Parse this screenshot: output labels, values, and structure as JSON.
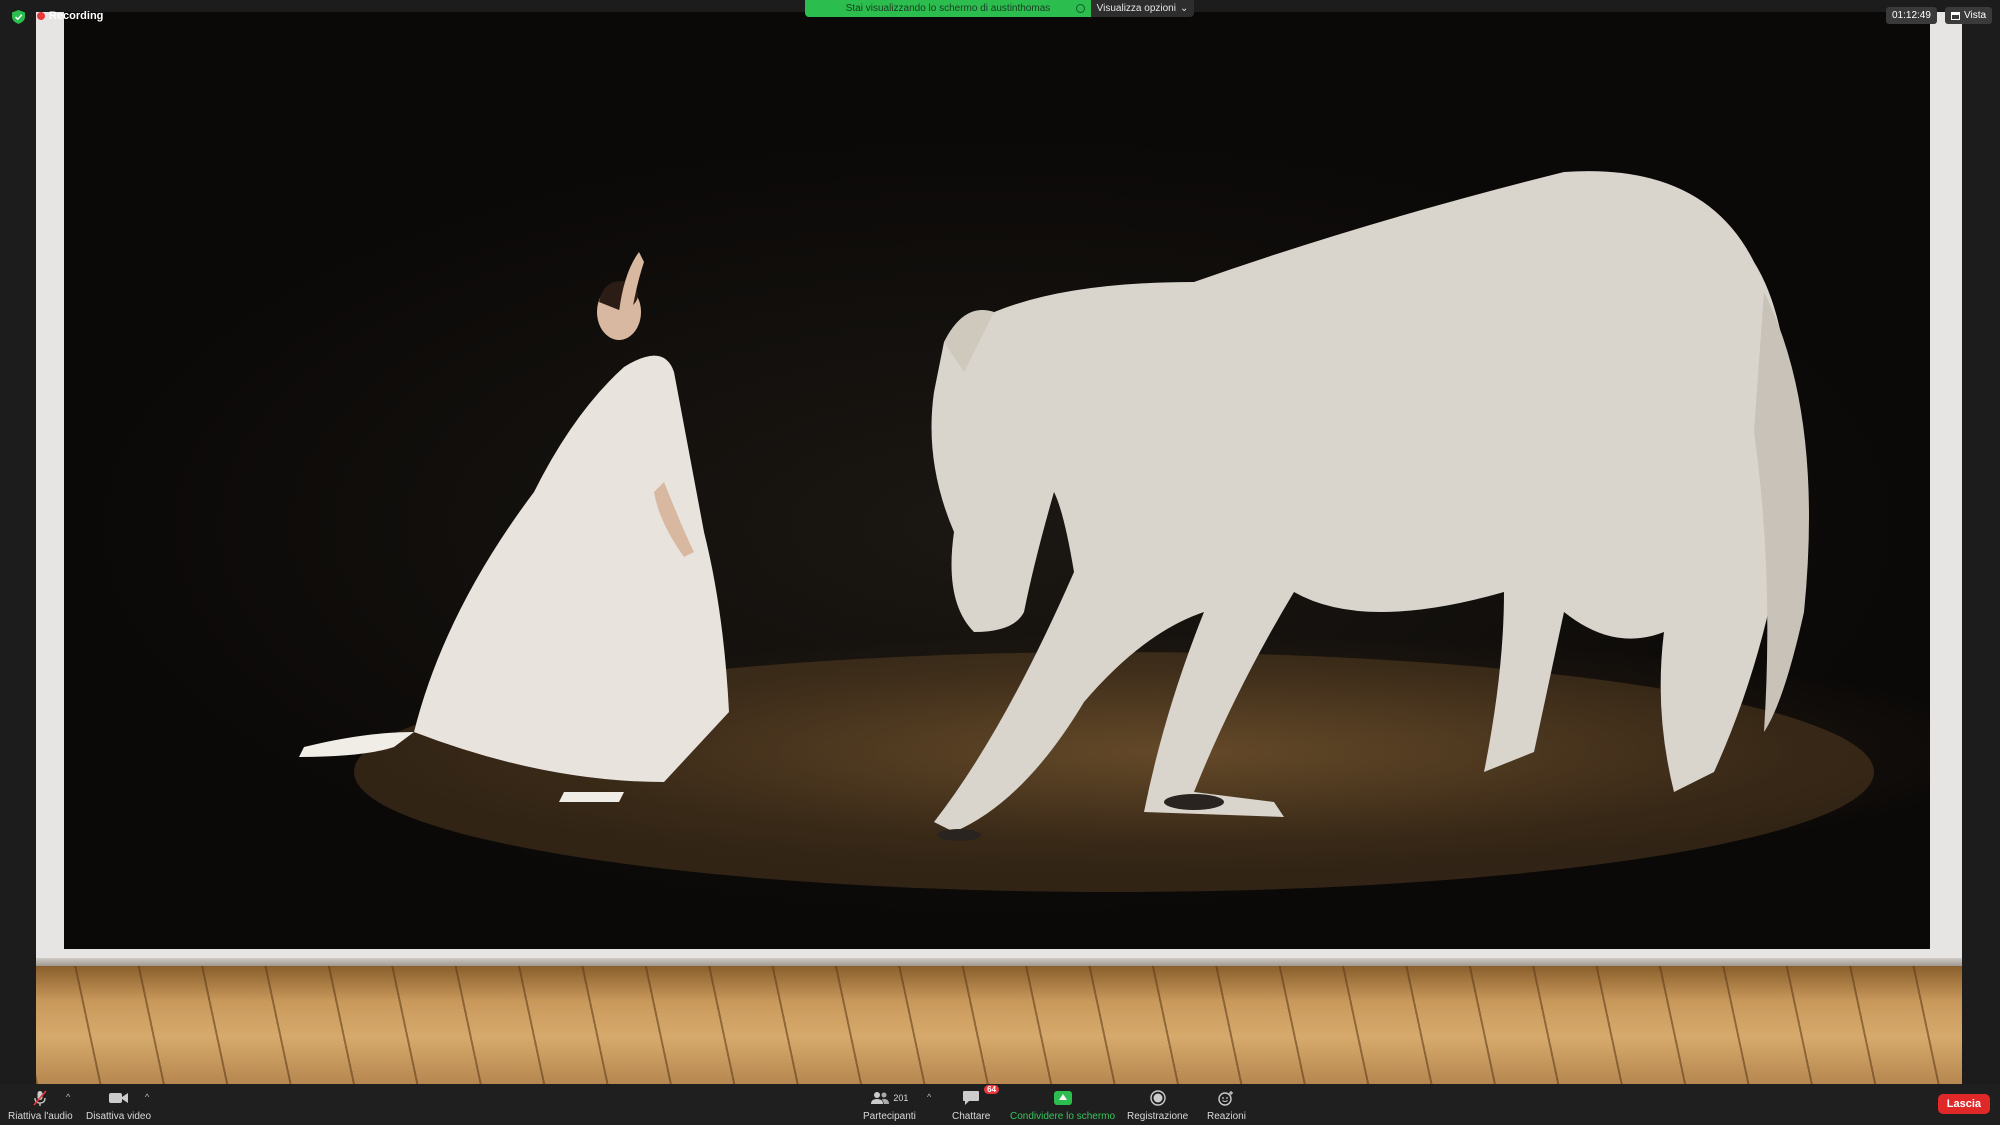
{
  "topbar": {
    "recording_label": "Recording",
    "share_banner_text": "Stai visualizzando lo schermo di austinthomas",
    "view_options_label": "Visualizza opzioni",
    "timer": "01:12:49",
    "view_label": "Vista"
  },
  "toolbar": {
    "audio_label": "Riattiva l'audio",
    "video_label": "Disattiva video",
    "participants_label": "Partecipanti",
    "participants_count": "201",
    "chat_label": "Chattare",
    "chat_badge": "64",
    "share_label": "Condividere lo schermo",
    "record_label": "Registrazione",
    "reactions_label": "Reazioni",
    "leave_label": "Lascia"
  },
  "colors": {
    "accent_green": "#2bbd4e",
    "leave_red": "#e02828",
    "recording_red": "#e8383d"
  }
}
